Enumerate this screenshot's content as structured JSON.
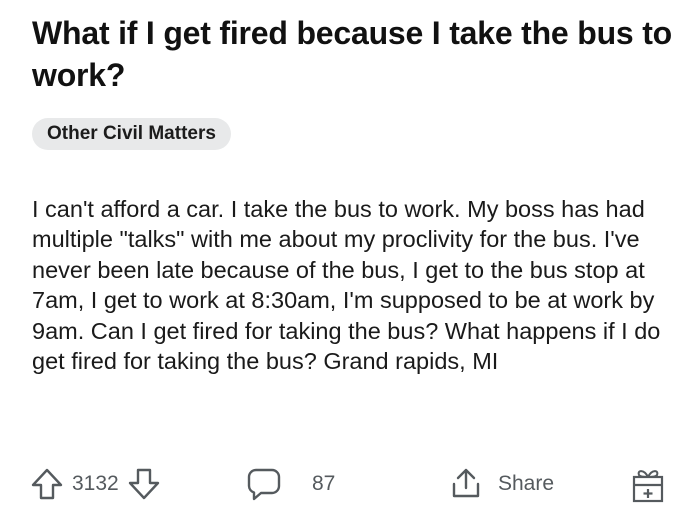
{
  "post": {
    "title": "What if I get fired because I take the bus to work?",
    "flair": "Other Civil Matters",
    "body": "I can't afford a car. I take the bus to work. My boss has had multiple \"talks\" with me about my proclivity for the bus. I've never been late because of the bus, I get to the bus stop at 7am, I get to work at 8:30am, I'm supposed to be at work by 9am. Can I get fired for taking the bus? What happens if I do get fired for taking the bus? Grand rapids, MI"
  },
  "actions": {
    "vote_count": "3132",
    "comment_count": "87",
    "share_label": "Share",
    "icons": {
      "upvote": "upvote-arrow-icon",
      "downvote": "downvote-arrow-icon",
      "comment": "comment-bubble-icon",
      "share": "share-upload-icon",
      "award": "award-gift-icon"
    }
  },
  "colors": {
    "text": "#1a1a1b",
    "icon": "#555a5e",
    "flair_bg": "#e8e9ea"
  }
}
